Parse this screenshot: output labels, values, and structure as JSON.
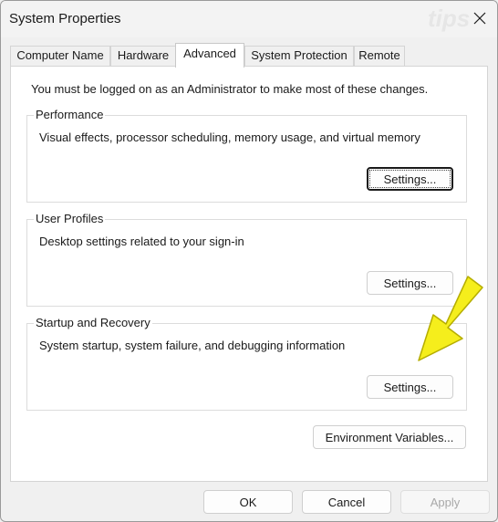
{
  "window": {
    "title": "System Properties",
    "watermark_text": "tips"
  },
  "tabs": [
    {
      "label": "Computer Name",
      "active": false
    },
    {
      "label": "Hardware",
      "active": false
    },
    {
      "label": "Advanced",
      "active": true
    },
    {
      "label": "System Protection",
      "active": false
    },
    {
      "label": "Remote",
      "active": false
    }
  ],
  "advanced": {
    "admin_note": "You must be logged on as an Administrator to make most of these changes.",
    "performance": {
      "legend": "Performance",
      "description": "Visual effects, processor scheduling, memory usage, and virtual memory",
      "button_label": "Settings..."
    },
    "user_profiles": {
      "legend": "User Profiles",
      "description": "Desktop settings related to your sign-in",
      "button_label": "Settings..."
    },
    "startup_recovery": {
      "legend": "Startup and Recovery",
      "description": "System startup, system failure, and debugging information",
      "button_label": "Settings..."
    },
    "env_vars_label": "Environment Variables..."
  },
  "footer": {
    "ok_label": "OK",
    "cancel_label": "Cancel",
    "apply_label": "Apply"
  },
  "colors": {
    "arrow_fill": "#f5ee1c",
    "arrow_stroke": "#b5ad00"
  },
  "icons": {
    "close": "close-icon",
    "pointer": "highlight-arrow-icon"
  }
}
